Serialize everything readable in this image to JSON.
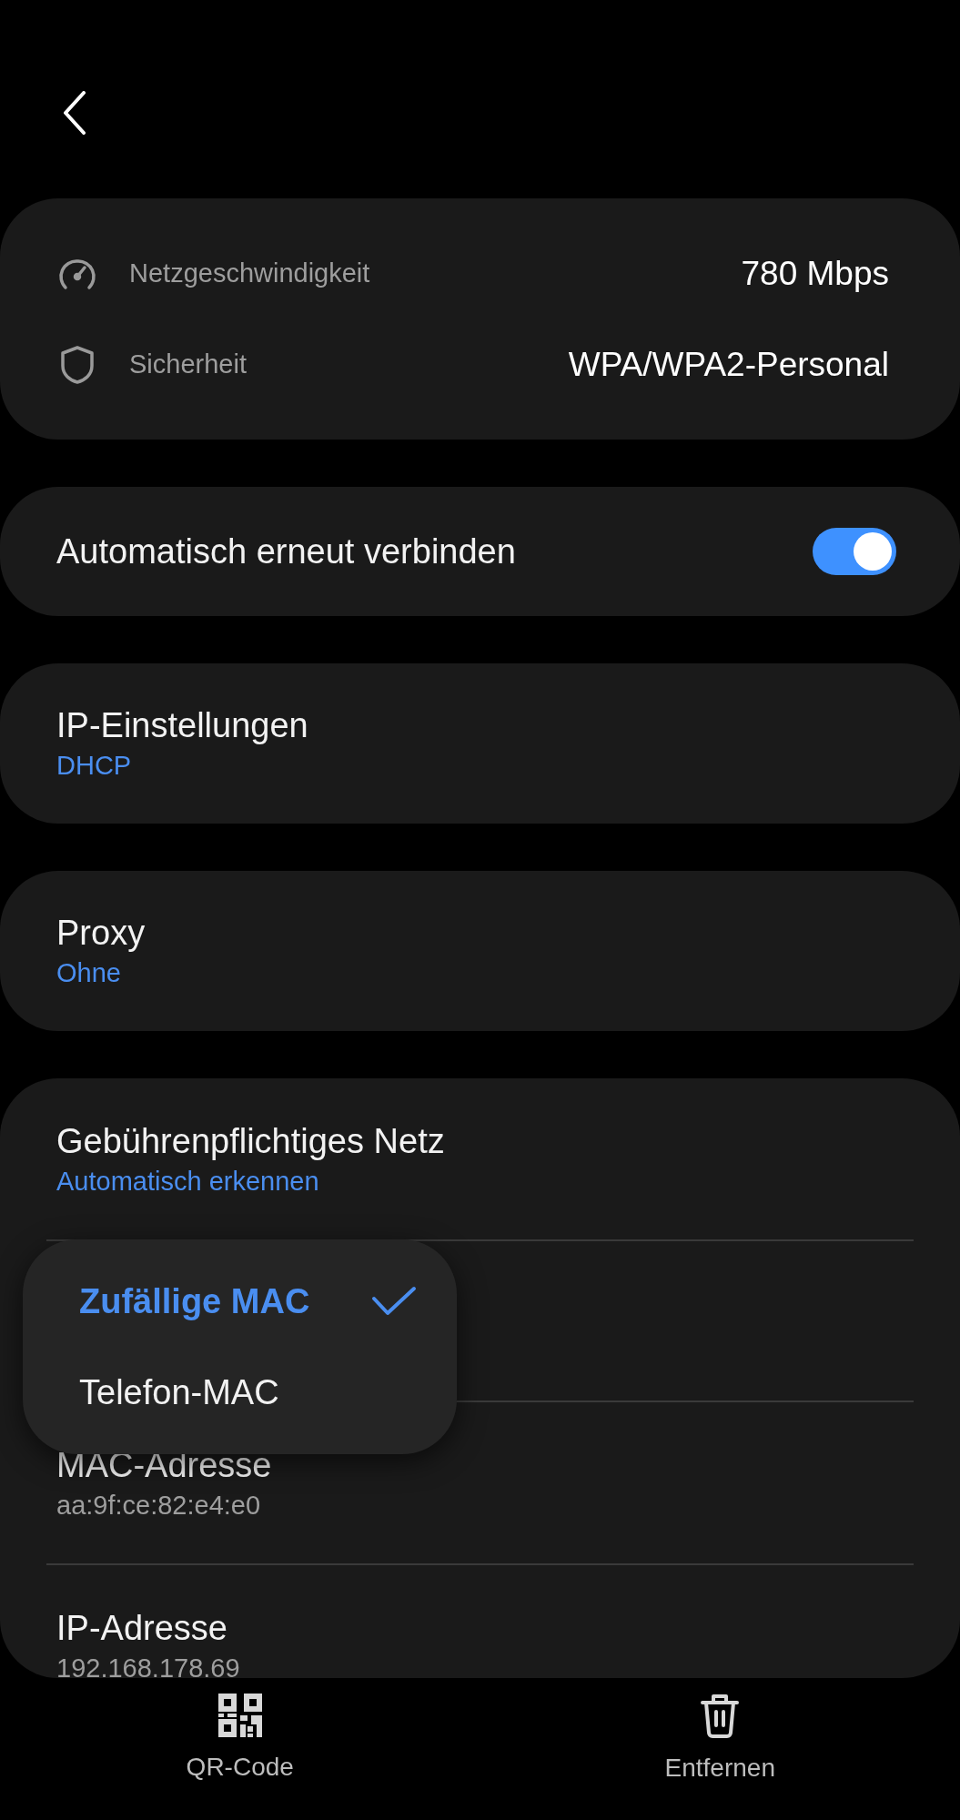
{
  "info": [
    {
      "kind": "speed",
      "label": "Netzgeschwindigkeit",
      "value": "780 Mbps"
    },
    {
      "kind": "security",
      "label": "Sicherheit",
      "value": "WPA/WPA2-Personal"
    }
  ],
  "auto_reconnect": {
    "label": "Automatisch erneut verbinden",
    "on": true
  },
  "settings": [
    {
      "title": "IP-Einstellungen",
      "value": "DHCP"
    },
    {
      "title": "Proxy",
      "value": "Ohne"
    }
  ],
  "details": [
    {
      "kind": "option",
      "title": "Gebührenpflichtiges Netz",
      "value": "Automatisch erkennen"
    },
    {
      "kind": "info",
      "title": "MAC-Adresse",
      "value": "aa:9f:ce:82:e4:e0"
    },
    {
      "kind": "info",
      "title": "IP-Adresse",
      "value": "192.168.178.69"
    }
  ],
  "mac_menu": {
    "options": [
      {
        "label": "Zufällige MAC",
        "selected": true
      },
      {
        "label": "Telefon-MAC",
        "selected": false
      }
    ]
  },
  "bottom_bar": [
    {
      "kind": "qr",
      "label": "QR-Code"
    },
    {
      "kind": "delete",
      "label": "Entfernen"
    }
  ]
}
